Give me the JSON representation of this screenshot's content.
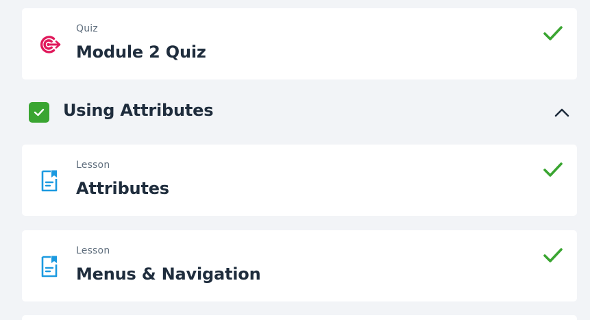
{
  "colors": {
    "background": "#f2f4f7",
    "card": "#ffffff",
    "complete_green": "#3aa531",
    "quiz_icon": "#e0195b",
    "lesson_icon": "#1c9ae0",
    "title_text": "#1f2d3d",
    "label_text": "#5f6e7d"
  },
  "items_top": [
    {
      "type": "Quiz",
      "title": "Module 2 Quiz",
      "icon": "quiz-target-icon",
      "status": "complete",
      "status_icon": "check-icon"
    }
  ],
  "section": {
    "title": "Using Attributes",
    "status": "complete",
    "status_icon": "checkbox-checked-icon",
    "toggle_icon": "chevron-up-icon",
    "expanded": true,
    "items": [
      {
        "type": "Lesson",
        "title": "Attributes",
        "icon": "lesson-document-icon",
        "status": "complete",
        "status_icon": "check-icon"
      },
      {
        "type": "Lesson",
        "title": "Menus & Navigation",
        "icon": "lesson-document-icon",
        "status": "complete",
        "status_icon": "check-icon"
      }
    ]
  }
}
